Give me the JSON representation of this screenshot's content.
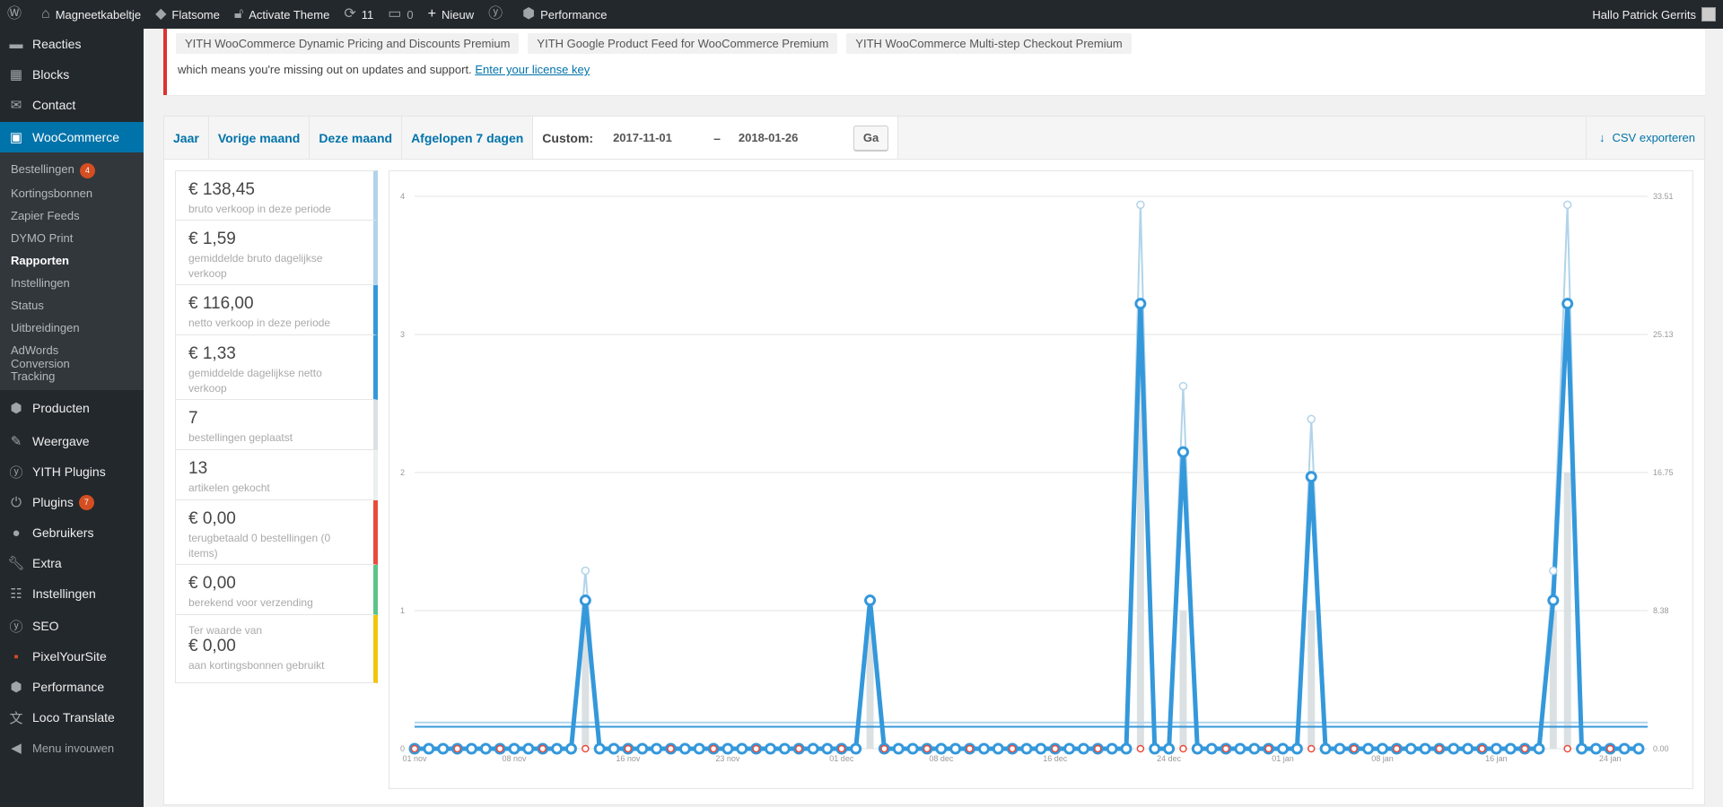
{
  "admin_bar": {
    "site_name": "Magneetkabeltje",
    "theme": "Flatsome",
    "activate_theme": "Activate Theme",
    "updates_count": "11",
    "comments_count": "0",
    "new_label": "Nieuw",
    "performance": "Performance",
    "greeting": "Hallo Patrick Gerrits"
  },
  "sidebar": {
    "items_top": [
      {
        "label": "Reacties",
        "icon": "comment-icon"
      },
      {
        "label": "Blocks",
        "icon": "blocks-icon"
      },
      {
        "label": "Contact",
        "icon": "mail-icon"
      }
    ],
    "woocommerce": {
      "label": "WooCommerce",
      "icon": "woo-icon"
    },
    "submenu": [
      {
        "label": "Bestellingen",
        "badge": "4"
      },
      {
        "label": "Kortingsbonnen"
      },
      {
        "label": "Zapier Feeds"
      },
      {
        "label": "DYMO Print"
      },
      {
        "label": "Rapporten",
        "current": true
      },
      {
        "label": "Instellingen"
      },
      {
        "label": "Status"
      },
      {
        "label": "Uitbreidingen"
      },
      {
        "label": "AdWords Conversion Tracking"
      }
    ],
    "items_bottom": [
      {
        "label": "Producten",
        "icon": "box-icon"
      },
      {
        "label": "Weergave",
        "icon": "brush-icon"
      },
      {
        "label": "YITH Plugins",
        "icon": "yith-icon"
      },
      {
        "label": "Plugins",
        "icon": "plug-icon",
        "badge": "7"
      },
      {
        "label": "Gebruikers",
        "icon": "user-icon"
      },
      {
        "label": "Extra",
        "icon": "wrench-icon"
      },
      {
        "label": "Instellingen",
        "icon": "settings-icon"
      },
      {
        "label": "SEO",
        "icon": "yoast-icon"
      },
      {
        "label": "PixelYourSite",
        "icon": "pixel-icon"
      },
      {
        "label": "Performance",
        "icon": "performance-icon"
      },
      {
        "label": "Loco Translate",
        "icon": "translate-icon"
      },
      {
        "label": "Menu invouwen",
        "icon": "collapse-icon"
      }
    ]
  },
  "notice": {
    "plugins": [
      "YITH WooCommerce Dynamic Pricing and Discounts Premium",
      "YITH Google Product Feed for WooCommerce Premium",
      "YITH WooCommerce Multi-step Checkout Premium"
    ],
    "text": "which means you're missing out on updates and support.",
    "link": "Enter your license key"
  },
  "report": {
    "tabs": [
      "Jaar",
      "Vorige maand",
      "Deze maand",
      "Afgelopen 7 dagen"
    ],
    "custom_label": "Custom:",
    "start_date": "2017-11-01",
    "dash": "–",
    "end_date": "2018-01-26",
    "go": "Ga",
    "csv": "CSV exporteren"
  },
  "legend": [
    {
      "value": "€ 138,45",
      "label": "bruto verkoop in deze periode",
      "color": "#b1d4ea"
    },
    {
      "value": "€ 1,59",
      "label": "gemiddelde bruto dagelijkse verkoop",
      "color": "#b1d4ea"
    },
    {
      "value": "€ 116,00",
      "label": "netto verkoop in deze periode",
      "color": "#3498db"
    },
    {
      "value": "€ 1,33",
      "label": "gemiddelde dagelijkse netto verkoop",
      "color": "#3498db"
    },
    {
      "value": "7",
      "label": "bestellingen geplaatst",
      "color": "#dbe1e3"
    },
    {
      "value": "13",
      "label": "artikelen gekocht",
      "color": "#ecf0f1"
    },
    {
      "value": "€ 0,00",
      "label": "terugbetaald 0 bestellingen (0 items)",
      "color": "#e74c3c"
    },
    {
      "value": "€ 0,00",
      "label": "berekend voor verzending",
      "color": "#5cc488"
    },
    {
      "prefix": "Ter waarde van",
      "value": "€ 0,00",
      "label": "aan kortingsbonnen gebruikt",
      "color": "#f1c40f"
    }
  ],
  "chart_data": {
    "type": "line",
    "x_start": "2017-11-01",
    "x_end": "2018-01-26",
    "x_tick_labels": [
      "01 nov",
      "08 nov",
      "16 nov",
      "23 nov",
      "01 dec",
      "08 dec",
      "16 dec",
      "24 dec",
      "01 jan",
      "08 jan",
      "16 jan",
      "24 jan"
    ],
    "y_left_ticks": [
      "0",
      "1",
      "2",
      "3",
      "4"
    ],
    "y_right_ticks": [
      "0.00",
      "8.38",
      "16.75",
      "25.13",
      "33.51"
    ],
    "ylim_left": [
      0,
      4
    ],
    "ylim_right": [
      0,
      33.51
    ],
    "grid": true,
    "spikes": [
      {
        "day": 12,
        "orders": 1,
        "gross": 10.8,
        "net": 9.0
      },
      {
        "day": 32,
        "orders": 1,
        "gross": 9.0,
        "net": 9.0
      },
      {
        "day": 51,
        "orders": 3,
        "gross": 33.0,
        "net": 27.0
      },
      {
        "day": 54,
        "orders": 1,
        "gross": 22.0,
        "net": 18.0
      },
      {
        "day": 63,
        "orders": 1,
        "gross": 20.0,
        "net": 16.5
      },
      {
        "day": 80,
        "orders": 1,
        "gross": 10.8,
        "net": 9.0
      },
      {
        "day": 81,
        "orders": 2,
        "gross": 33.0,
        "net": 27.0
      }
    ],
    "average_gross": 1.59,
    "average_net": 1.33,
    "series": [
      {
        "name": "bruto verkoop in deze periode",
        "color": "#b1d4ea"
      },
      {
        "name": "netto verkoop in deze periode",
        "color": "#3498db"
      },
      {
        "name": "bestellingen geplaatst",
        "color": "#dbe1e3"
      },
      {
        "name": "terugbetaald 0 bestellingen (0 items)",
        "color": "#e74c3c"
      }
    ]
  }
}
